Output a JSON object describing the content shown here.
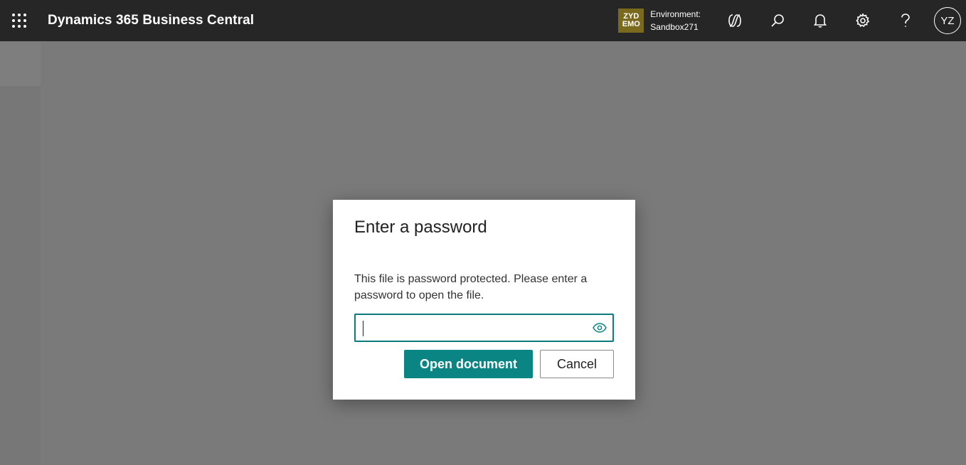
{
  "header": {
    "app_title": "Dynamics 365 Business Central",
    "environment_badge": {
      "line1": "ZYD",
      "line2": "EMO",
      "color": "#7a6a1e"
    },
    "environment_label": "Environment:",
    "environment_name": "Sandbox271",
    "icons": [
      "waffle-icon",
      "copilot-icon",
      "search-icon",
      "bell-icon",
      "gear-icon",
      "help-icon"
    ],
    "user_initials": "YZ"
  },
  "dialog": {
    "title": "Enter a password",
    "message": "This file is password protected. Please enter a password to open the file.",
    "password_value": "",
    "primary_button": "Open document",
    "secondary_button": "Cancel",
    "accent_color": "#0b8484"
  }
}
